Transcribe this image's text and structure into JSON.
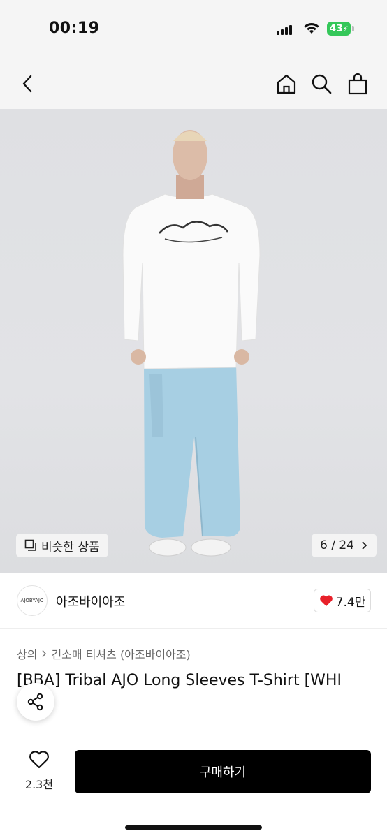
{
  "status_bar": {
    "time": "00:19",
    "battery": "43"
  },
  "nav": {
    "back_icon": "chevron-left-icon",
    "home_icon": "home-icon",
    "search_icon": "search-icon",
    "bag_icon": "shopping-bag-icon"
  },
  "image": {
    "similar_label": "비슷한 상품",
    "page_counter": "6 / 24",
    "graphic_text": "AJO"
  },
  "seller": {
    "logo_text": "AJOBYAJO",
    "name": "아조바이아조",
    "likes": "7.4만"
  },
  "breadcrumb": {
    "category": "상의",
    "subcategory": "긴소매 티셔츠 (아조바이아조)"
  },
  "product": {
    "title": "[BBA] Tribal AJO Long Sleeves T-Shirt [WHI"
  },
  "bottom": {
    "wish_count": "2.3천",
    "buy_label": "구매하기"
  },
  "colors": {
    "accent": "#000000",
    "heart": "#e8202a",
    "battery": "#34c759"
  }
}
